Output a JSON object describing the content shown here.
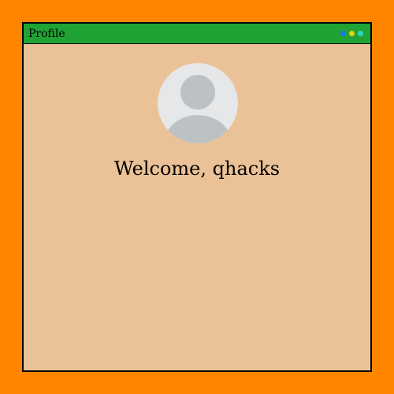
{
  "window": {
    "title": "Profile",
    "controls": [
      {
        "icon": "dot-blue-icon",
        "color": "#1E73E8"
      },
      {
        "icon": "dot-yellow-icon",
        "color": "#E6D014"
      },
      {
        "icon": "dot-teal-icon",
        "color": "#2FD2C8"
      }
    ]
  },
  "profile": {
    "avatar_icon": "user-avatar-placeholder-icon",
    "welcome_text": "Welcome, qhacks"
  },
  "colors": {
    "page_background": "#FF8500",
    "window_background": "#EBC297",
    "titlebar": "#1FA334",
    "avatar_bg": "#E6E7E8",
    "avatar_silhouette": "#BCC2C4"
  }
}
